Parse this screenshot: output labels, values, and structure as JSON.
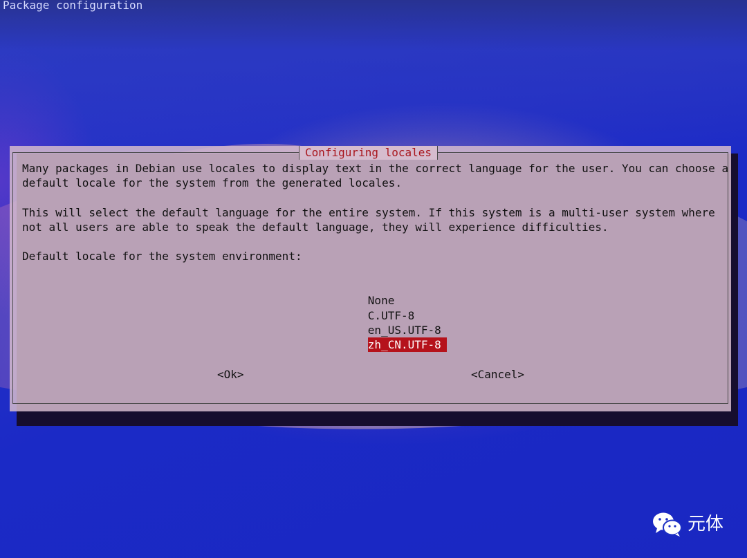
{
  "window": {
    "title": "Package configuration"
  },
  "dialog": {
    "title": "Configuring locales",
    "paragraph1": "Many packages in Debian use locales to display text in the correct language for the user. You can choose a\ndefault locale for the system from the generated locales.",
    "paragraph2": "This will select the default language for the entire system. If this system is a multi-user system where\nnot all users are able to speak the default language, they will experience difficulties.",
    "prompt": "Default locale for the system environment:",
    "options": [
      {
        "label": "None",
        "selected": false
      },
      {
        "label": "C.UTF-8",
        "selected": false
      },
      {
        "label": "en_US.UTF-8",
        "selected": false
      },
      {
        "label": "zh_CN.UTF-8",
        "selected": true
      }
    ],
    "buttons": {
      "ok": "<Ok>",
      "cancel": "<Cancel>"
    }
  },
  "watermark": {
    "text": "元体",
    "icon": "wechat-icon"
  },
  "colors": {
    "selection_bg": "#b5121b",
    "title_color": "#a8151c",
    "background_blue": "#1c2fc4"
  }
}
